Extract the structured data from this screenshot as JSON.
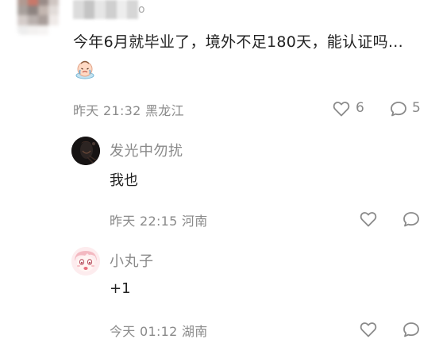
{
  "comment": {
    "author_tail": "o",
    "text": "今年6月就毕业了，境外不足180天，能认证吗...",
    "emoji_icon": "crying-face-sticker",
    "time": "昨天 21:32",
    "location": "黑龙江",
    "like_count": "6",
    "reply_count": "5"
  },
  "replies": [
    {
      "author": "发光中勿扰",
      "text": "我也",
      "time": "昨天 22:15",
      "location": "河南"
    },
    {
      "author": "小丸子",
      "text": "+1",
      "time": "今天 01:12",
      "location": "湖南"
    }
  ],
  "colors": {
    "text": "#222222",
    "meta": "#8a8a8a",
    "icon": "#8a8a8a"
  }
}
